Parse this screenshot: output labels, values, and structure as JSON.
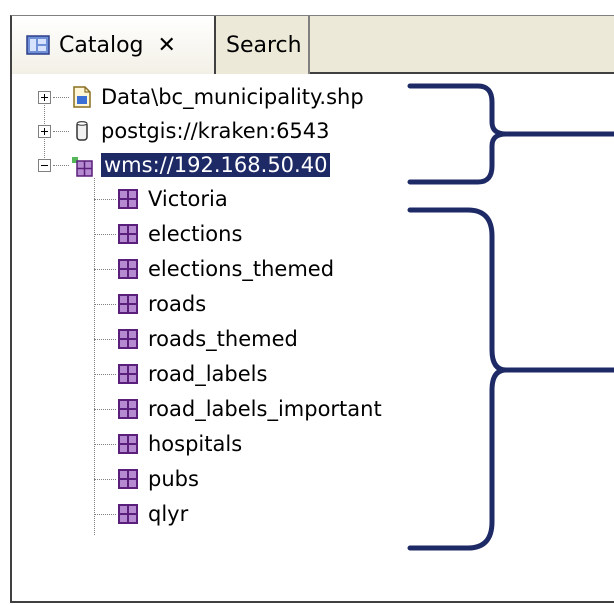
{
  "tabs": {
    "catalog_label": "Catalog",
    "close_glyph": "✕",
    "search_label": "Search"
  },
  "tree": {
    "nodes": [
      {
        "label": "Data\\bc_municipality.shp",
        "icon": "shapefile-icon",
        "expanded": false
      },
      {
        "label": "postgis://kraken:6543",
        "icon": "database-icon",
        "expanded": false
      },
      {
        "label": "wms://192.168.50.40",
        "icon": "wms-server-icon",
        "expanded": true,
        "selected": true
      }
    ],
    "layers": [
      "Victoria",
      "elections",
      "elections_themed",
      "roads",
      "roads_themed",
      "road_labels",
      "road_labels_important",
      "hospitals",
      "pubs",
      "qlyr"
    ]
  },
  "colors": {
    "selection_bg": "#1e2a66",
    "brace": "#1e2a66",
    "layer_icon": "#b58ad0"
  }
}
